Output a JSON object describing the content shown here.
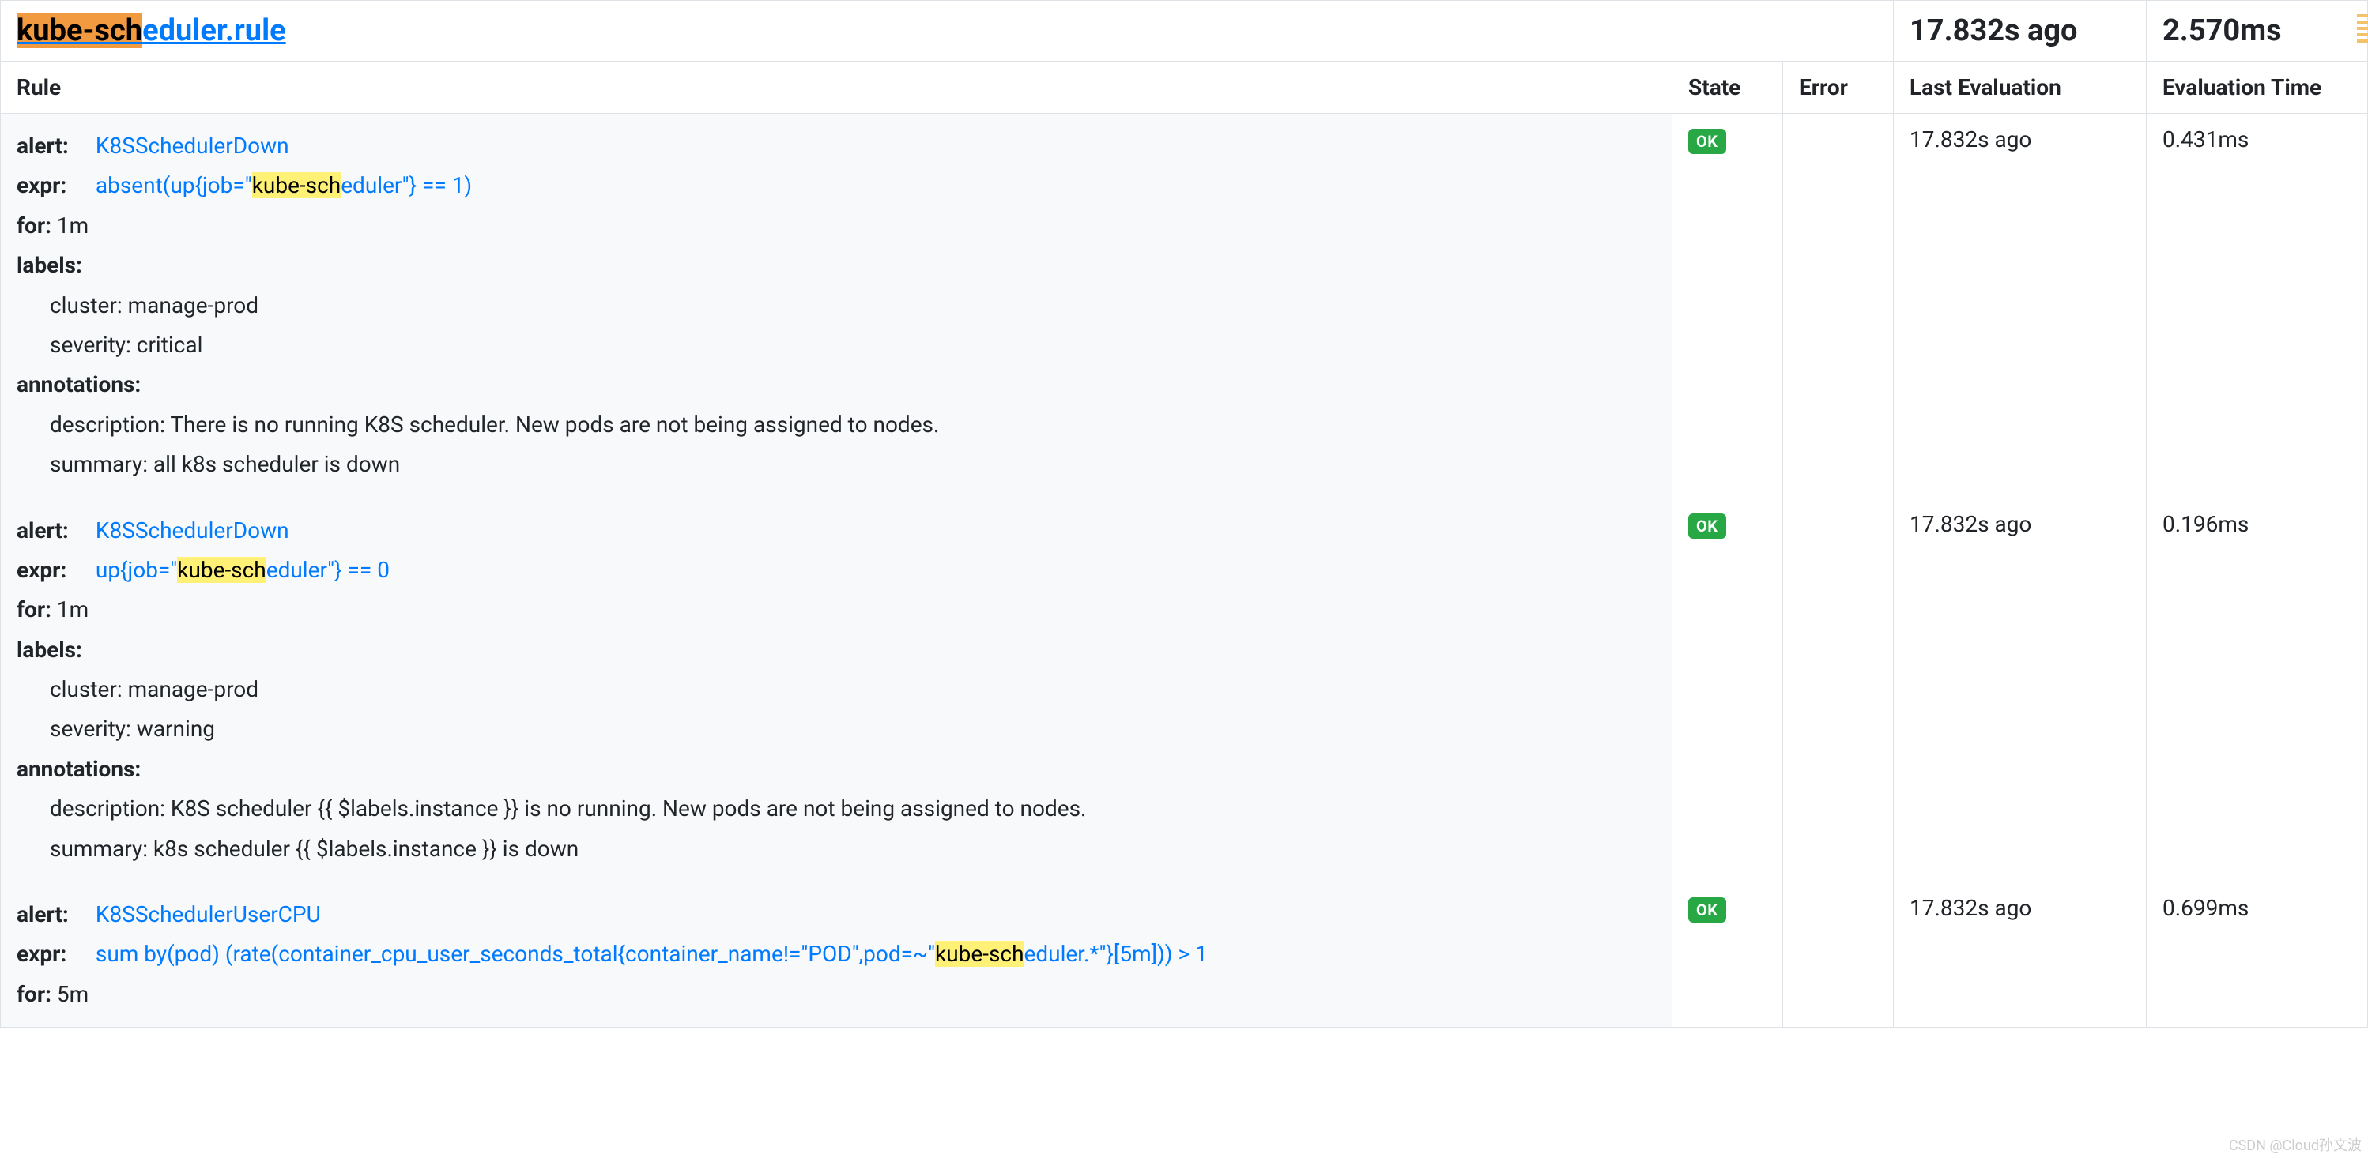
{
  "highlight": "kube-sch",
  "group": {
    "name_rest": "eduler.rule",
    "last_eval": "17.832s ago",
    "eval_time": "2.570ms"
  },
  "headers": {
    "rule": "Rule",
    "state": "State",
    "error": "Error",
    "last_eval": "Last Evaluation",
    "eval_time": "Evaluation Time"
  },
  "field_labels": {
    "alert": "alert:",
    "expr": "expr:",
    "for": "for:",
    "labels": "labels:",
    "annotations": "annotations:"
  },
  "rules": [
    {
      "alert": "K8SSchedulerDown",
      "expr_pre": "absent(up{job=\"",
      "expr_post": "eduler\"} == 1)",
      "for": "1m",
      "labels": {
        "cluster": "cluster: manage-prod",
        "severity": "severity: critical"
      },
      "annotations": {
        "description": "description: There is no running K8S scheduler. New pods are not being assigned to nodes.",
        "summary": "summary: all k8s scheduler is down"
      },
      "state": "OK",
      "error": "",
      "last_eval": "17.832s ago",
      "eval_time": "0.431ms"
    },
    {
      "alert": "K8SSchedulerDown",
      "expr_pre": "up{job=\"",
      "expr_post": "eduler\"} == 0",
      "for": "1m",
      "labels": {
        "cluster": "cluster: manage-prod",
        "severity": "severity: warning"
      },
      "annotations": {
        "description": "description: K8S scheduler {{ $labels.instance }} is no running. New pods are not being assigned to nodes.",
        "summary": "summary: k8s scheduler {{ $labels.instance }} is down"
      },
      "state": "OK",
      "error": "",
      "last_eval": "17.832s ago",
      "eval_time": "0.196ms"
    },
    {
      "alert": "K8SSchedulerUserCPU",
      "expr_pre": "sum by(pod) (rate(container_cpu_user_seconds_total{container_name!=\"POD\",pod=~\"",
      "expr_post": "eduler.*\"}[5m])) > 1",
      "for": "5m",
      "labels": null,
      "annotations": null,
      "state": "OK",
      "error": "",
      "last_eval": "17.832s ago",
      "eval_time": "0.699ms"
    }
  ],
  "watermark": "CSDN @Cloud孙文波"
}
